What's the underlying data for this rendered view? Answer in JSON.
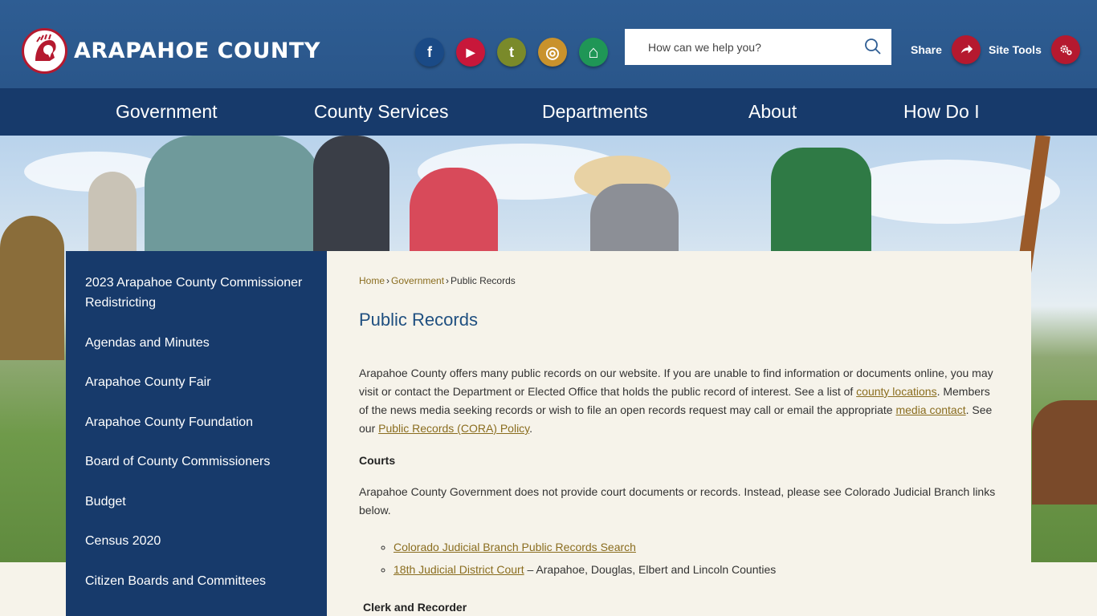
{
  "header": {
    "logo_text": "ARAPAHOE COUNTY",
    "search": {
      "placeholder": "How can we help you?"
    },
    "share_label": "Share",
    "site_tools_label": "Site Tools",
    "social": [
      {
        "name": "facebook-icon",
        "glyph": "f"
      },
      {
        "name": "youtube-icon",
        "glyph": "▶"
      },
      {
        "name": "twitter-icon",
        "glyph": "t"
      },
      {
        "name": "instagram-icon",
        "glyph": "◎"
      },
      {
        "name": "home-icon",
        "glyph": "⌂"
      }
    ]
  },
  "nav": {
    "items": [
      {
        "label": "Government"
      },
      {
        "label": "County Services"
      },
      {
        "label": "Departments"
      },
      {
        "label": "About"
      },
      {
        "label": "How Do I"
      }
    ]
  },
  "sidebar": {
    "items": [
      {
        "label": "2023 Arapahoe County Commissioner Redistricting"
      },
      {
        "label": "Agendas and Minutes"
      },
      {
        "label": "Arapahoe County Fair"
      },
      {
        "label": "Arapahoe County Foundation"
      },
      {
        "label": "Board of County Commissioners"
      },
      {
        "label": "Budget"
      },
      {
        "label": "Census 2020"
      },
      {
        "label": "Citizen Boards and Committees"
      }
    ]
  },
  "breadcrumb": {
    "home": "Home",
    "government": "Government",
    "current": "Public Records",
    "sep": "›"
  },
  "content": {
    "title": "Public Records",
    "intro_1": "Arapahoe County offers many public records on our website. If you are unable to find information or documents online, you may visit or contact the Department or Elected Office that holds the public record of interest. See a list of ",
    "intro_link_1": "county locations",
    "intro_2": ". Members of the news media seeking records or wish to file an open records request may call or email the appropriate ",
    "intro_link_2": "media contact",
    "intro_3": ". See our ",
    "intro_link_3": "Public Records (CORA) Policy",
    "intro_4": ".",
    "courts_heading": "Courts",
    "courts_text": "Arapahoe County Government does not provide court documents or records. Instead, please see Colorado Judicial Branch links below.",
    "court_link_1": "Colorado Judicial Branch Public Records Search",
    "court_link_2": "18th Judicial District Court",
    "court_link_2_suffix": " – Arapahoe, Douglas, Elbert and Lincoln Counties",
    "clerk_heading": "Clerk and Recorder"
  },
  "colors": {
    "header_blue": "#2e5d93",
    "nav_blue": "#173a6b",
    "accent_red": "#b5192f",
    "link_gold": "#8a6d1f",
    "title_blue": "#1f4f80"
  }
}
